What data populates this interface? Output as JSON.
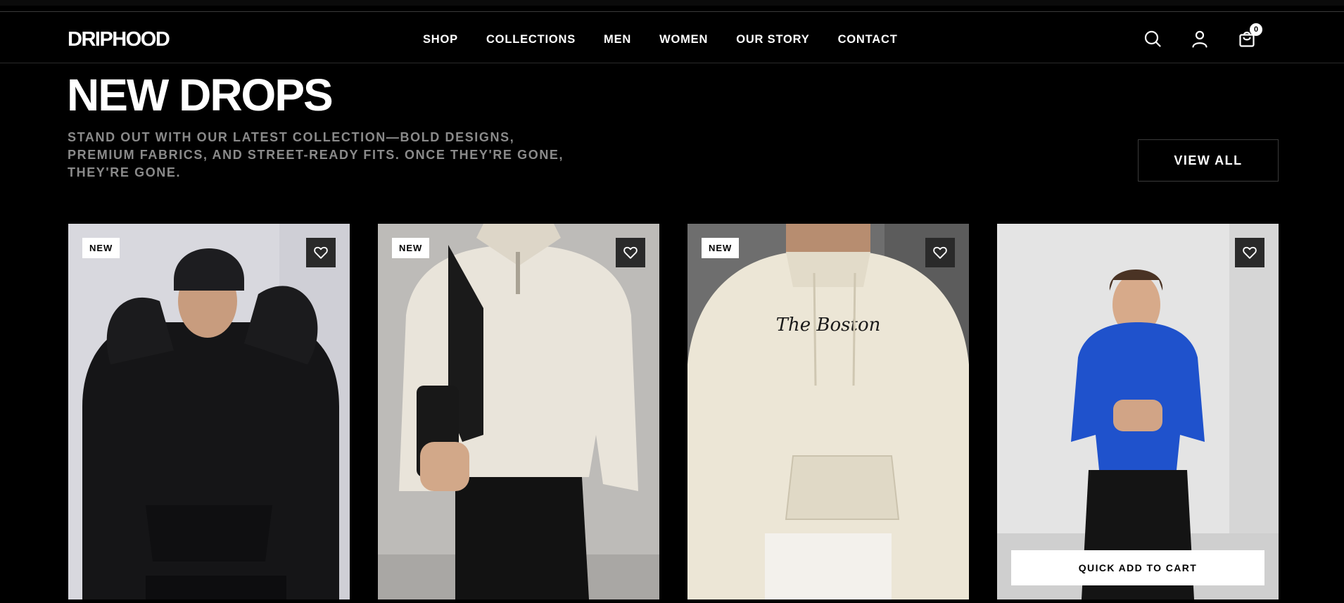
{
  "header": {
    "logo": "DRIPHOOD",
    "nav": [
      "SHOP",
      "COLLECTIONS",
      "MEN",
      "WOMEN",
      "OUR STORY",
      "CONTACT"
    ],
    "icons": [
      "search-icon",
      "account-icon",
      "cart-icon"
    ],
    "cart_count": "0"
  },
  "section": {
    "title": "NEW DROPS",
    "subtitle": "STAND OUT WITH OUR LATEST COLLECTION—BOLD DESIGNS, PREMIUM FABRICS, AND STREET-READY FITS. ONCE THEY'RE GONE, THEY'RE GONE.",
    "view_all": "VIEW ALL"
  },
  "products": [
    {
      "badge": "NEW",
      "image": "model-in-black-hoodie-and-beanie"
    },
    {
      "badge": "NEW",
      "image": "model-in-cream-half-zip-with-backpack"
    },
    {
      "badge": "NEW",
      "image": "cream-hoodie-the-boston-print"
    },
    {
      "badge": "",
      "image": "model-in-blue-hoodie",
      "quick_add": "QUICK ADD TO CART"
    }
  ],
  "colors": {
    "background": "#000000",
    "text": "#ffffff",
    "muted": "#8a8a8a",
    "wishlist_button": "#2a2a2a"
  }
}
